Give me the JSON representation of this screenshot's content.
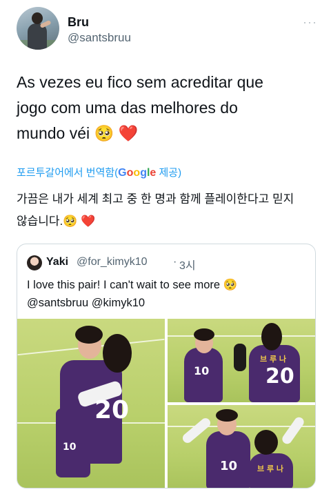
{
  "author": {
    "display_name": "Bru",
    "handle": "@santsbruu",
    "more_icon": "more-icon"
  },
  "tweet": {
    "lines": [
      "As vezes eu fico sem acreditar que",
      "jogo com uma das melhores do",
      "mundo véi 🥺 ❤️"
    ]
  },
  "translation_bar": {
    "prefix": "포르투갈어에서 번역함(",
    "google": [
      "G",
      "o",
      "o",
      "g",
      "l",
      "e"
    ],
    "suffix": " 제공)"
  },
  "translated": {
    "lines": [
      "가끔은 내가 세계 최고 중 한 명과 함께 플레이한다고 믿지",
      "않습니다.🥺 ❤️"
    ]
  },
  "quote": {
    "name": "Yaki",
    "handle": "@for_kimyk10",
    "separator": "·",
    "time": "3시",
    "lines": [
      "I love this pair! I can't wait to see more 🥺",
      "@santsbruu @kimyk10"
    ],
    "photo_numbers": {
      "big": "20",
      "big_short": "10",
      "top_right_left": "10",
      "top_right_right": "20",
      "bottom_right": "10"
    },
    "photo_korean": {
      "top_right": "브 루 나",
      "bottom_right": "브 루 나"
    }
  },
  "colors": {
    "link": "#1d9bf0",
    "secondary": "#536471",
    "jersey": "#4a2a6d"
  }
}
